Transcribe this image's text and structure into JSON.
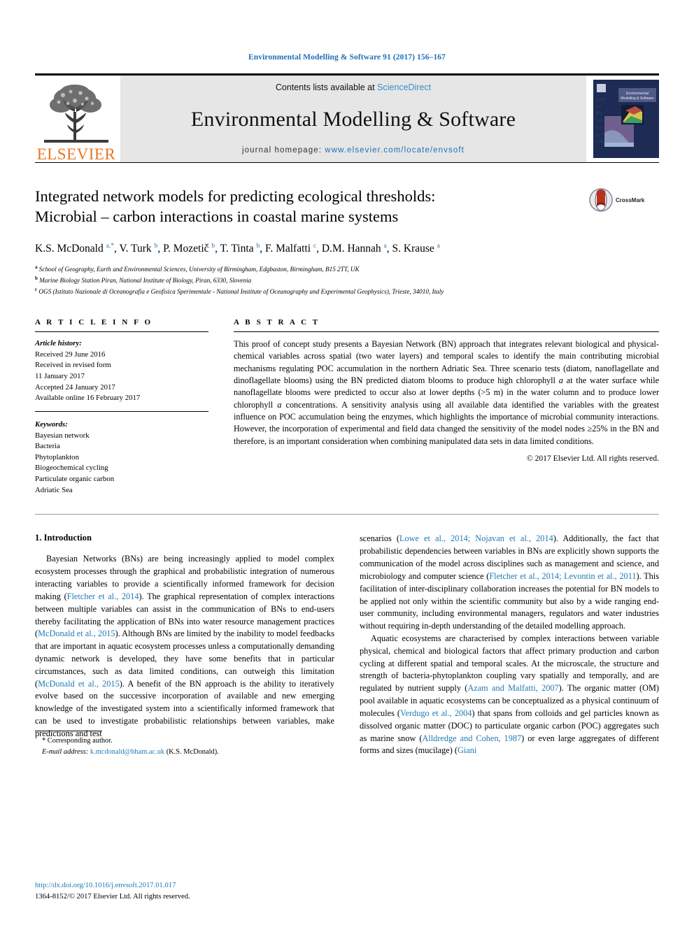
{
  "running_head": "Environmental Modelling & Software 91 (2017) 156–167",
  "masthead": {
    "publisher": "ELSEVIER",
    "contents_prefix": "Contents lists available at ",
    "contents_link": "ScienceDirect",
    "journal_title": "Environmental Modelling & Software",
    "homepage_prefix": "journal homepage: ",
    "homepage_url": "www.elsevier.com/locate/envsoft",
    "cover_title": "Environmental Modelling & Software"
  },
  "article": {
    "title_line1": "Integrated network models for predicting ecological thresholds:",
    "title_line2": "Microbial – carbon interactions in coastal marine systems",
    "crossmark_label": "CrossMark",
    "authors": "K.S. McDonald a,*, V. Turk b, P. Mozetič b, T. Tinta b, F. Malfatti c, D.M. Hannah a, S. Krause a",
    "affiliations": [
      {
        "marker": "a",
        "text": "School of Geography, Earth and Environmental Sciences, University of Birmingham, Edgbaston, Birmingham, B15 2TT, UK"
      },
      {
        "marker": "b",
        "text": "Marine Biology Station Piran, National Institute of Biology, Piran, 6330, Slovenia"
      },
      {
        "marker": "c",
        "text": "OGS (Istituto Nazionale di Oceanografia e Geofisica Sperimentale - National Institute of Oceanography and Experimental Geophysics), Trieste, 34010, Italy"
      }
    ]
  },
  "article_info": {
    "heading": "A R T I C L E   I N F O",
    "history_label": "Article history:",
    "history": [
      "Received 29 June 2016",
      "Received in revised form",
      "11 January 2017",
      "Accepted 24 January 2017",
      "Available online 16 February 2017"
    ],
    "keywords_label": "Keywords:",
    "keywords": [
      "Bayesian network",
      "Bacteria",
      "Phytoplankton",
      "Biogeochemical cycling",
      "Particulate organic carbon",
      "Adriatic Sea"
    ]
  },
  "abstract": {
    "heading": "A B S T R A C T",
    "text_part1": "This proof of concept study presents a Bayesian Network (BN) approach that integrates relevant biological and physical-chemical variables across spatial (two water layers) and temporal scales to identify the main contributing microbial mechanisms regulating POC accumulation in the northern Adriatic Sea. Three scenario tests (diatom, nanoflagellate and dinoflagellate blooms) using the BN predicted diatom blooms to produce high chlorophyll ",
    "italic1": "a",
    "text_part2": " at the water surface while nanoflagellate blooms were predicted to occur also at lower depths (>5 m) in the water column and to produce lower chlorophyll ",
    "italic2": "a",
    "text_part3": " concentrations. A sensitivity analysis using all available data identified the variables with the greatest influence on POC accumulation being the enzymes, which highlights the importance of microbial community interactions. However, the incorporation of experimental and field data changed the sensitivity of the model nodes ≥25% in the BN and therefore, is an important consideration when combining manipulated data sets in data limited conditions.",
    "copyright": "© 2017 Elsevier Ltd. All rights reserved."
  },
  "introduction": {
    "heading": "1.  Introduction",
    "left_p1_a": "Bayesian Networks (BNs) are being increasingly applied to model complex ecosystem processes through the graphical and probabilistic integration of numerous interacting variables to provide a scientifically informed framework for decision making (",
    "left_ref1": "Fletcher et al., 2014",
    "left_p1_b": "). The graphical representation of complex interactions between multiple variables can assist in the communication of BNs to end-users thereby facilitating the application of BNs into water resource management practices (",
    "left_ref2": "McDonald et al., 2015",
    "left_p1_c": "). Although BNs are limited by the inability to model feedbacks that are important in aquatic ecosystem processes unless a computationally demanding dynamic network is developed, they have some benefits that in particular circumstances, such as data limited conditions, can outweigh this limitation (",
    "left_ref3": "McDonald et al., 2015",
    "left_p1_d": "). A benefit of the BN approach is the ability to iteratively evolve based on the successive incorporation of available and new emerging knowledge of the investigated system into a scientifically informed framework that can be used to investigate probabilistic relationships between variables, make predictions and test",
    "right_p1_a": "scenarios (",
    "right_ref1": "Lowe et al., 2014; Nojavan et al., 2014",
    "right_p1_b": "). Additionally, the fact that probabilistic dependencies between variables in BNs are explicitly shown supports the communication of the model across disciplines such as management and science, and microbiology and computer science (",
    "right_ref2": "Fletcher et al., 2014; Levontin et al., 2011",
    "right_p1_c": "). This facilitation of inter-disciplinary collaboration increases the potential for BN models to be applied not only within the scientific community but also by a wide ranging end-user community, including environmental managers, regulators and water industries without requiring in-depth understanding of the detailed modelling approach.",
    "right_p2_a": "Aquatic ecosystems are characterised by complex interactions between variable physical, chemical and biological factors that affect primary production and carbon cycling at different spatial and temporal scales. At the microscale, the structure and strength of bacteria-phytoplankton coupling vary spatially and temporally, and are regulated by nutrient supply (",
    "right_ref3": "Azam and Malfatti, 2007",
    "right_p2_b": "). The organic matter (OM) pool available in aquatic ecosystems can be conceptualized as a physical continuum of molecules (",
    "right_ref4": "Verdugo et al., 2004",
    "right_p2_c": ") that spans from colloids and gel particles known as dissolved organic matter (DOC) to particulate organic carbon (POC) aggregates such as marine snow (",
    "right_ref5": "Alldredge and Cohen, 1987",
    "right_p2_d": ") or even large aggregates of different forms and sizes (mucilage) (",
    "right_ref6": "Giani"
  },
  "footnote": {
    "corresponding": "* Corresponding author.",
    "email_label": "E-mail address: ",
    "email": "k.mcdonald@bham.ac.uk",
    "email_suffix": " (K.S. McDonald)."
  },
  "footer": {
    "doi": "http://dx.doi.org/10.1016/j.envsoft.2017.01.017",
    "issn_line": "1364-8152/© 2017 Elsevier Ltd. All rights reserved."
  },
  "colors": {
    "link": "#1f7ab5",
    "running_head": "#1f6fb5",
    "elsevier_orange": "#E87722",
    "masthead_bg": "#e6e6e6"
  }
}
